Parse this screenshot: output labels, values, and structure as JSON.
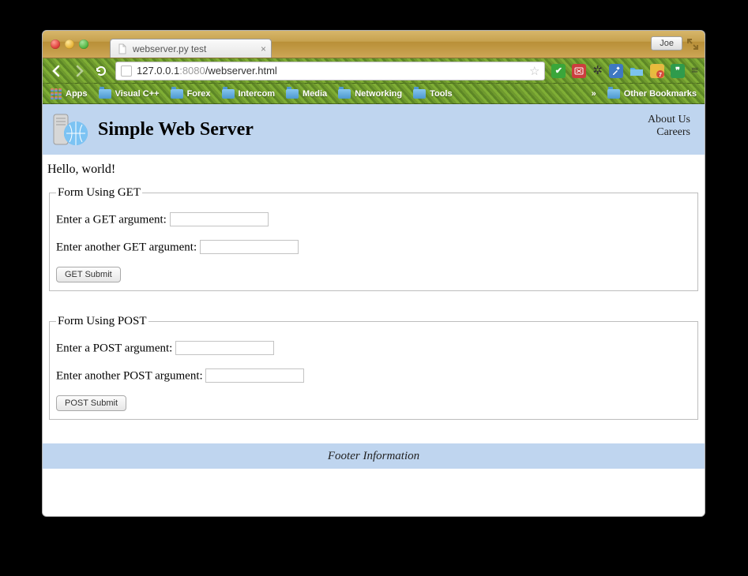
{
  "window": {
    "traffic": [
      "close",
      "minimize",
      "zoom"
    ],
    "tab_title": "webserver.py test",
    "user": "Joe"
  },
  "toolbar": {
    "url_host": "127.0.0.1",
    "url_port": ":8080",
    "url_path": "/webserver.html"
  },
  "bookmarks": {
    "apps": "Apps",
    "items": [
      "Visual C++",
      "Forex",
      "Intercom",
      "Media",
      "Networking",
      "Tools"
    ],
    "other": "Other Bookmarks"
  },
  "page": {
    "title": "Simple Web Server",
    "links": [
      "About Us",
      "Careers"
    ],
    "hello": "Hello, world!",
    "form_get": {
      "legend": "Form Using GET",
      "label1": "Enter a GET argument:",
      "label2": "Enter another GET argument:",
      "submit": "GET Submit"
    },
    "form_post": {
      "legend": "Form Using POST",
      "label1": "Enter a POST argument:",
      "label2": "Enter another POST argument:",
      "submit": "POST Submit"
    },
    "footer": "Footer Information"
  }
}
